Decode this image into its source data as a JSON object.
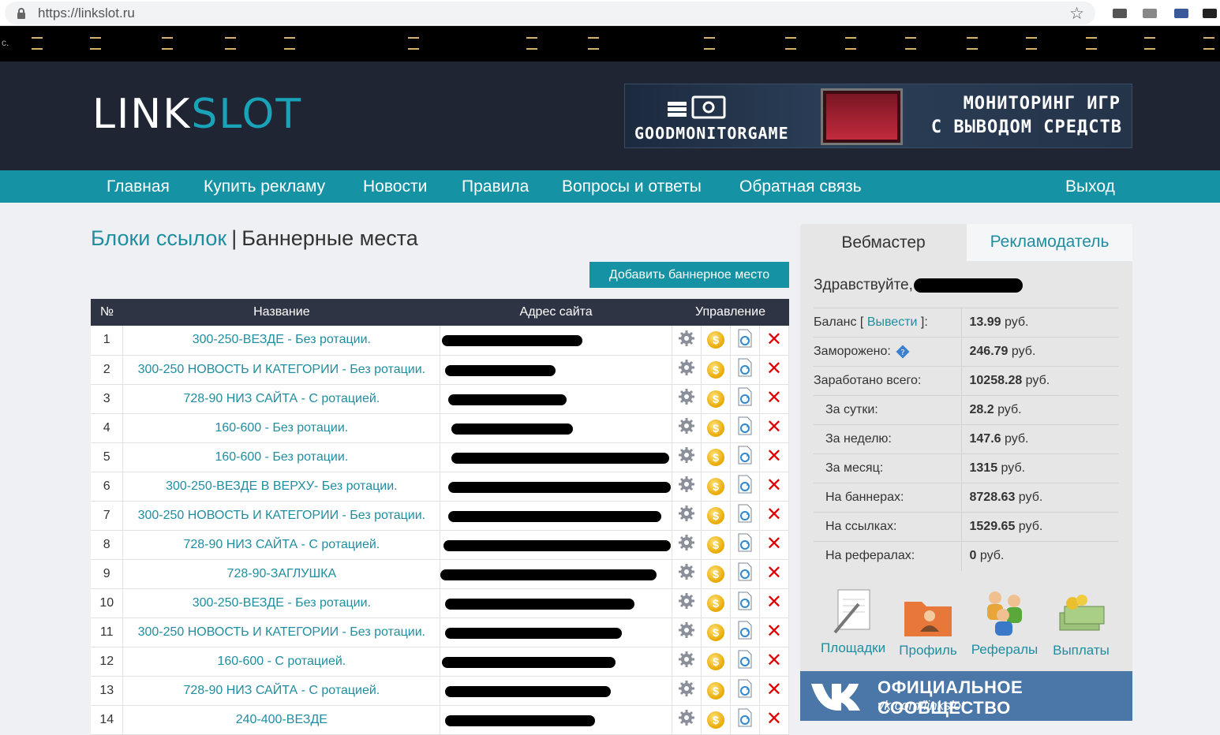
{
  "browser": {
    "url": "https://linkslot.ru"
  },
  "header": {
    "logo_part1": "LINK",
    "logo_part2": "SLOT",
    "ad": {
      "brand": "GOODMONITORGAME",
      "line1": "МОНИТОРИНГ ИГР",
      "line2": "С ВЫВОДОМ СРЕДСТВ"
    }
  },
  "nav": {
    "items": [
      "Главная",
      "Купить рекламу",
      "Новости",
      "Правила",
      "Вопросы и ответы",
      "Обратная связь"
    ],
    "logout": "Выход"
  },
  "main": {
    "breadcrumb_link": "Блоки ссылок",
    "separator": "|",
    "title": "Баннерные места",
    "add_button": "Добавить баннерное место",
    "table": {
      "headers": [
        "№",
        "Название",
        "Адрес сайта",
        "Управление"
      ],
      "rows": [
        {
          "num": "1",
          "name": "300-250-ВЕЗДЕ - Без ротации."
        },
        {
          "num": "2",
          "name": "300-250 НОВОСТЬ И КАТЕГОРИИ - Без ротации."
        },
        {
          "num": "3",
          "name": "728-90 НИЗ САЙТА - С ротацией."
        },
        {
          "num": "4",
          "name": "160-600 - Без ротации."
        },
        {
          "num": "5",
          "name": "160-600 - Без ротации."
        },
        {
          "num": "6",
          "name": "300-250-ВЕЗДЕ В ВЕРХУ- Без ротации."
        },
        {
          "num": "7",
          "name": "300-250 НОВОСТЬ И КАТЕГОРИИ - Без ротации."
        },
        {
          "num": "8",
          "name": "728-90 НИЗ САЙТА - С ротацией."
        },
        {
          "num": "9",
          "name": "728-90-ЗАГЛУШКА"
        },
        {
          "num": "10",
          "name": "300-250-ВЕЗДЕ - Без ротации."
        },
        {
          "num": "11",
          "name": "300-250 НОВОСТЬ И КАТЕГОРИИ - Без ротации."
        },
        {
          "num": "12",
          "name": "160-600 - С ротацией."
        },
        {
          "num": "13",
          "name": "728-90 НИЗ САЙТА - С ротацией."
        },
        {
          "num": "14",
          "name": "240-400-ВЕЗДЕ"
        }
      ]
    }
  },
  "sidebar": {
    "tab_webmaster": "Вебмастер",
    "tab_advertiser": "Рекламодатель",
    "greeting": "Здравствуйте,",
    "stats": [
      {
        "label": "Баланс [ ",
        "link": "Вывести",
        "label_end": " ]:",
        "value": "13.99",
        "unit": " руб."
      },
      {
        "label": "Заморожено:",
        "value": "246.79",
        "unit": " руб."
      },
      {
        "label": "Заработано всего:",
        "value": "10258.28",
        "unit": " руб."
      },
      {
        "label": "За сутки:",
        "value": "28.2",
        "unit": " руб."
      },
      {
        "label": "За неделю:",
        "value": "147.6",
        "unit": " руб."
      },
      {
        "label": "За месяц:",
        "value": "1315",
        "unit": " руб."
      },
      {
        "label": "На баннерах:",
        "value": "8728.63",
        "unit": " руб."
      },
      {
        "label": "На ссылках:",
        "value": "1529.65",
        "unit": " руб."
      },
      {
        "label": "На рефералах:",
        "value": "0",
        "unit": " руб."
      }
    ],
    "quick_links": [
      "Площадки",
      "Профиль",
      "Рефералы",
      "Выплаты"
    ],
    "vk": {
      "line1": "ОФИЦИАЛЬНОЕ СООБЩЕСТВО",
      "line2": "vk.com/linkslot"
    }
  },
  "colors": {
    "accent": "#1593a5",
    "header_bg": "#1f2533",
    "table_head": "#2e3444",
    "delete": "#e00000",
    "vk": "#4a76a8"
  }
}
